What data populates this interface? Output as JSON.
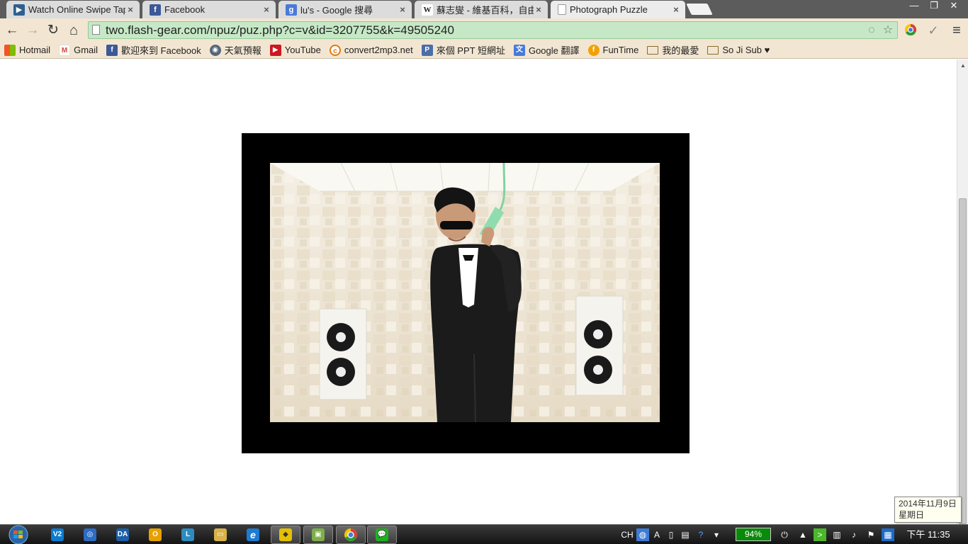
{
  "tabs": [
    {
      "title": "Watch Online Swipe Tap",
      "close": "×",
      "icon": "video-icon",
      "color": "#2f5f8f"
    },
    {
      "title": "Facebook",
      "close": "×",
      "icon": "facebook-icon",
      "color": "#3b5998"
    },
    {
      "title": "lu's - Google 搜尋",
      "close": "×",
      "icon": "google-icon",
      "color": "#4a7ad8"
    },
    {
      "title": "蘇志燮 - 維基百科，自由的",
      "close": "×",
      "icon": "wikipedia-icon",
      "color": "#ffffff"
    },
    {
      "title": "Photograph Puzzle",
      "close": "×",
      "icon": "page-icon",
      "color": "#ffffff"
    }
  ],
  "window_controls": {
    "minimize": "—",
    "maximize": "❐",
    "close": "✕"
  },
  "toolbar": {
    "back": "←",
    "forward": "→",
    "reload": "↻",
    "home": "⌂",
    "url": "two.flash-gear.com/npuz/puz.php?c=v&id=3207755&k=49505240",
    "menu": "≡"
  },
  "bookmarks": [
    {
      "label": "Hotmail",
      "icon": "windows-icon",
      "color": "#f35325"
    },
    {
      "label": "Gmail",
      "icon": "gmail-icon",
      "color": "#d44638"
    },
    {
      "label": "歡迎來到 Facebook",
      "icon": "facebook-icon",
      "color": "#3b5998"
    },
    {
      "label": "天氣預報",
      "icon": "weather-icon",
      "color": "#556677"
    },
    {
      "label": "YouTube",
      "icon": "youtube-icon",
      "color": "#cc181e"
    },
    {
      "label": "convert2mp3.net",
      "icon": "convert-icon",
      "color": "#e07a10"
    },
    {
      "label": "來個 PPT 短網址",
      "icon": "ppt-icon",
      "color": "#4b6ea9"
    },
    {
      "label": "Google 翻譯",
      "icon": "translate-icon",
      "color": "#4a7ad8"
    },
    {
      "label": "FunTime",
      "icon": "funtime-icon",
      "color": "#f2a100"
    },
    {
      "label": "我的最愛",
      "icon": "folder-icon",
      "color": "#8a6a2a"
    },
    {
      "label": "So Ji Sub ♥",
      "icon": "folder-icon",
      "color": "#8a6a2a"
    }
  ],
  "tooltip": {
    "date": "2014年11月9日",
    "weekday": "星期日"
  },
  "taskbar": {
    "apps": [
      {
        "label": "V2",
        "icon": "v2-icon",
        "color": "#0c7bd0"
      },
      {
        "label": "",
        "icon": "internet-explorer-blue-icon",
        "color": "#2c6cc4"
      },
      {
        "label": "DA",
        "icon": "daemon-icon",
        "color": "#1c5ea8"
      },
      {
        "label": "O",
        "icon": "outlook-icon",
        "color": "#e8a000"
      },
      {
        "label": "L",
        "icon": "lync-icon",
        "color": "#2e8bc0"
      },
      {
        "label": "",
        "icon": "file-explorer-icon",
        "color": "#d8b24a"
      },
      {
        "label": "e",
        "icon": "internet-explorer-icon",
        "color": "#1f7ad1"
      },
      {
        "label": "",
        "icon": "flash-app-icon",
        "color": "#e5c000"
      },
      {
        "label": "",
        "icon": "photo-viewer-icon",
        "color": "#7dae4a"
      },
      {
        "label": "",
        "icon": "chrome-icon",
        "color": "#d6403a"
      },
      {
        "label": "",
        "icon": "line-icon",
        "color": "#1fb01f"
      }
    ],
    "ime": "CH",
    "battery": "94%",
    "clock": "下午 11:35"
  }
}
